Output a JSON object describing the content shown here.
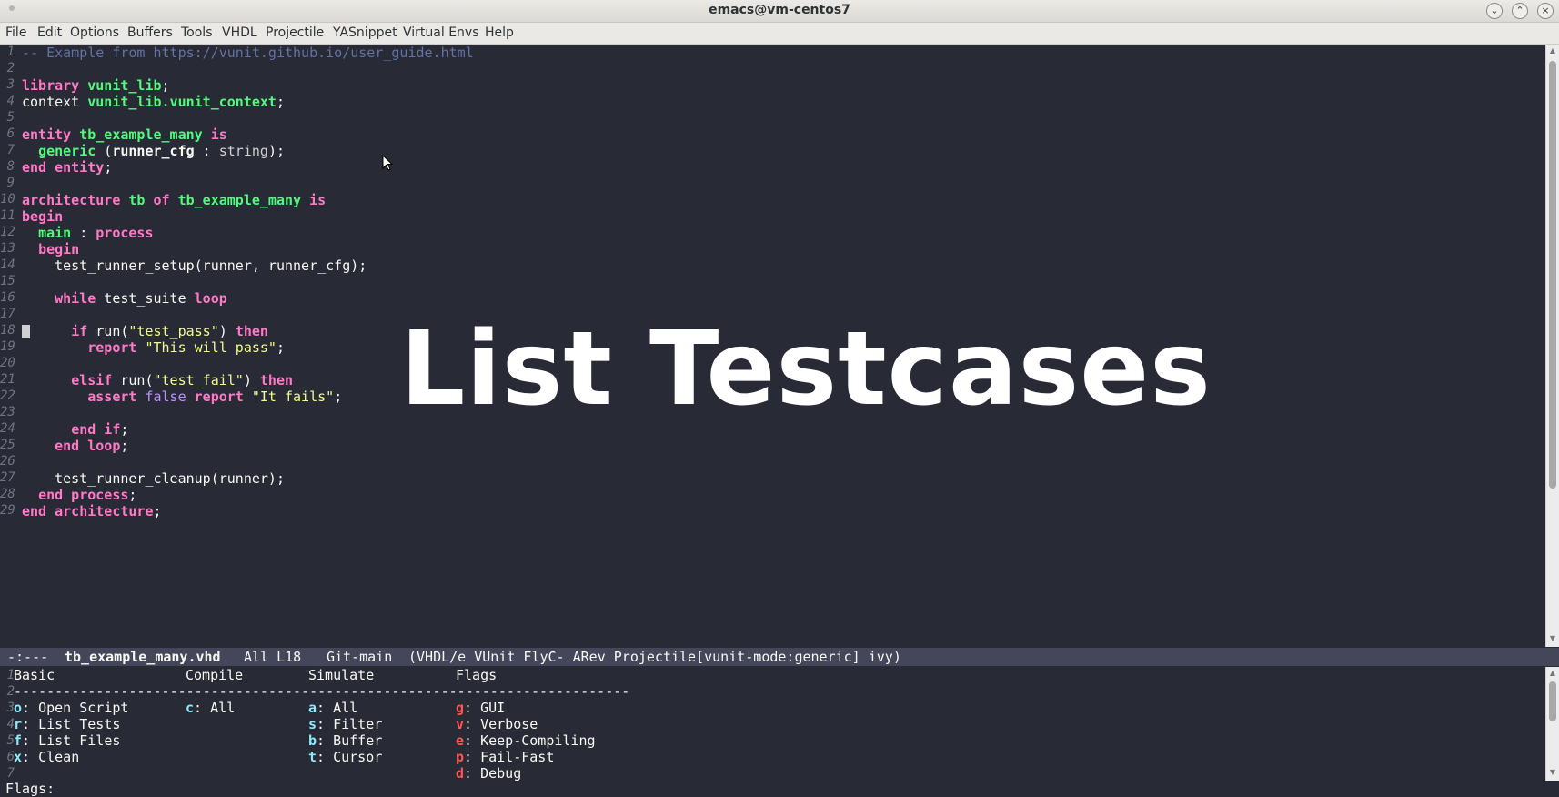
{
  "window": {
    "title": "emacs@vm-centos7"
  },
  "menubar": {
    "items": [
      "File",
      "Edit",
      "Options",
      "Buffers",
      "Tools",
      "VHDL",
      "Projectile",
      "YASnippet",
      "Virtual Envs",
      "Help"
    ]
  },
  "editor": {
    "line_numbers": [
      "1",
      "2",
      "3",
      "4",
      "5",
      "6",
      "7",
      "8",
      "9",
      "10",
      "11",
      "12",
      "13",
      "14",
      "15",
      "16",
      "17",
      "18",
      "19",
      "20",
      "21",
      "22",
      "23",
      "24",
      "25",
      "26",
      "27",
      "28",
      "29"
    ],
    "code": {
      "l1_comment": "-- Example from https://vunit.github.io/user_guide.html",
      "l3_kw": "library",
      "l3_name": "vunit_lib",
      "l3_end": ";",
      "l4_kw": "context",
      "l4_name": "vunit_lib.vunit_context",
      "l4_end": ";",
      "l6_kw1": "entity",
      "l6_name": "tb_example_many",
      "l6_kw2": "is",
      "l7_kw": "generic",
      "l7_open": " (",
      "l7_id": "runner_cfg",
      "l7_colon": " : ",
      "l7_type": "string",
      "l7_end": ");",
      "l8_kw": "end entity",
      "l8_end": ";",
      "l10_kw1": "architecture",
      "l10_name1": "tb",
      "l10_kw2": "of",
      "l10_name2": "tb_example_many",
      "l10_kw3": "is",
      "l11_kw": "begin",
      "l12_name": "main",
      "l12_colon": " : ",
      "l12_kw": "process",
      "l13_kw": "begin",
      "l14_text": "test_runner_setup(runner, runner_cfg);",
      "l16_kw1": "while",
      "l16_text": " test_suite ",
      "l16_kw2": "loop",
      "l18_kw1": "if",
      "l18_text": " run(",
      "l18_str": "\"test_pass\"",
      "l18_close": ") ",
      "l18_kw2": "then",
      "l19_kw": "report",
      "l19_str": "\"This will pass\"",
      "l19_end": ";",
      "l21_kw1": "elsif",
      "l21_text": " run(",
      "l21_str": "\"test_fail\"",
      "l21_close": ") ",
      "l21_kw2": "then",
      "l22_kw1": "assert",
      "l22_type": "false",
      "l22_kw2": "report",
      "l22_str": "\"It fails\"",
      "l22_end": ";",
      "l24_kw": "end if",
      "l24_end": ";",
      "l25_kw": "end loop",
      "l25_end": ";",
      "l27_text": "test_runner_cleanup(runner);",
      "l28_kw": "end process",
      "l28_end": ";",
      "l29_kw": "end architecture",
      "l29_end": ";"
    }
  },
  "overlay": {
    "text": "List Testcases"
  },
  "modeline": {
    "state": "-:---",
    "buffer": "tb_example_many.vhd",
    "position": "All L18",
    "vc": "Git-main",
    "modes": "(VHDL/e VUnit FlyC- ARev Projectile[vunit-mode:generic] ivy)"
  },
  "hydra": {
    "line_numbers": [
      "1",
      "2",
      "3",
      "4",
      "5",
      "6",
      "7"
    ],
    "headers": {
      "basic": "Basic",
      "compile": "Compile",
      "simulate": "Simulate",
      "flags": "Flags"
    },
    "separator": "---------------------------------------------------------------------------",
    "basic": [
      {
        "key": "o",
        "label": ": Open Script"
      },
      {
        "key": "r",
        "label": ": List Tests"
      },
      {
        "key": "f",
        "label": ": List Files"
      },
      {
        "key": "x",
        "label": ": Clean"
      }
    ],
    "compile": [
      {
        "key": "c",
        "label": ": All"
      }
    ],
    "simulate": [
      {
        "key": "a",
        "label": ": All"
      },
      {
        "key": "s",
        "label": ": Filter"
      },
      {
        "key": "b",
        "label": ": Buffer"
      },
      {
        "key": "t",
        "label": ": Cursor"
      }
    ],
    "flags": [
      {
        "key": "g",
        "label": ": GUI"
      },
      {
        "key": "v",
        "label": ": Verbose"
      },
      {
        "key": "e",
        "label": ": Keep-Compiling"
      },
      {
        "key": "p",
        "label": ": Fail-Fast"
      },
      {
        "key": "d",
        "label": ": Debug"
      }
    ]
  },
  "minibuffer": {
    "text": "Flags:"
  },
  "colors": {
    "background": "#282a36",
    "keyword": "#ff79c6",
    "name": "#50fa7b",
    "string": "#f1fa8c",
    "comment": "#6272a4",
    "modeline": "#44475a",
    "hydra_key": "#8be9fd",
    "hydra_flag_key": "#ff5555"
  }
}
